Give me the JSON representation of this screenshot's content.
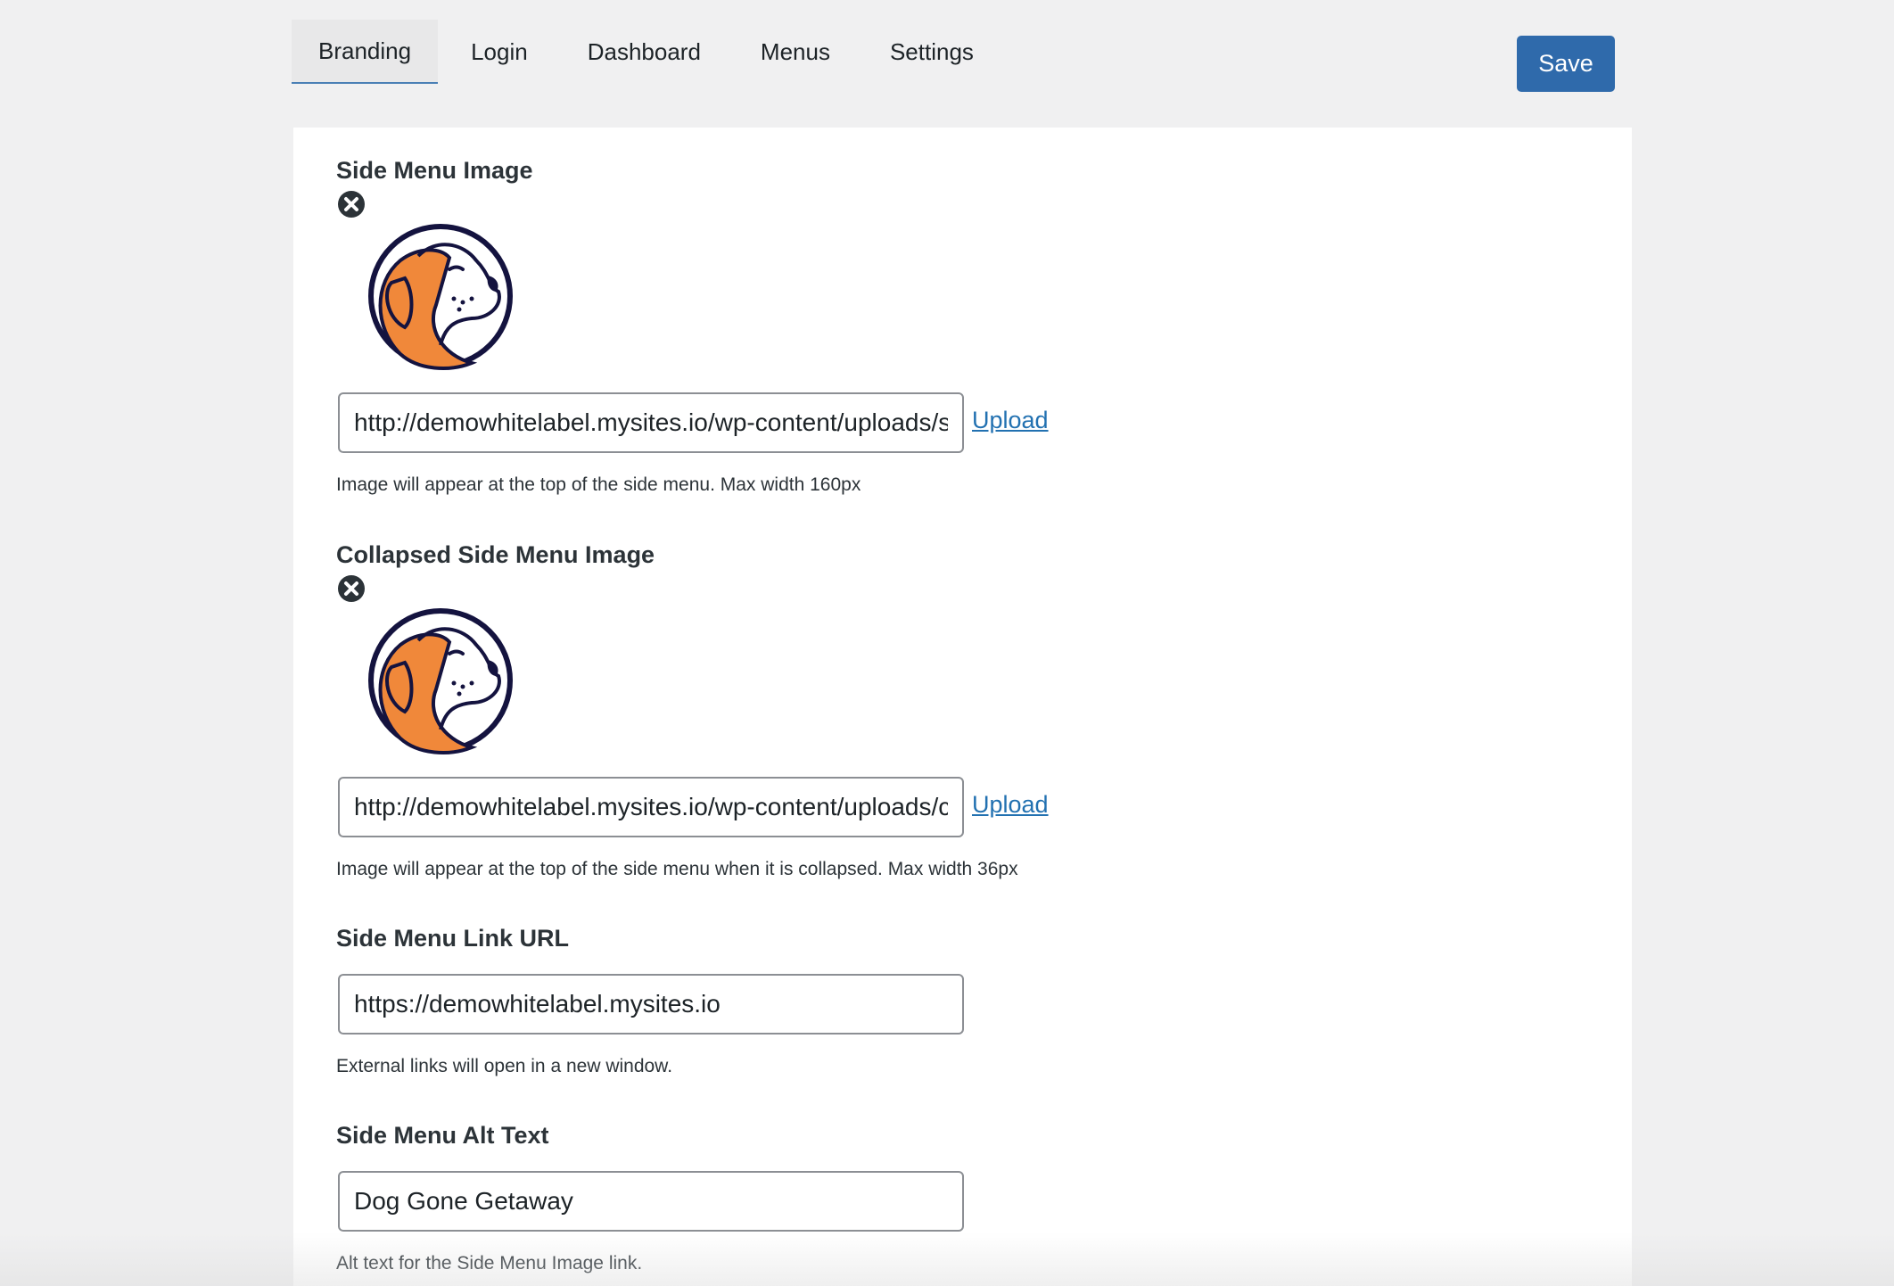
{
  "tabs": [
    {
      "label": "Branding",
      "active": true
    },
    {
      "label": "Login",
      "active": false
    },
    {
      "label": "Dashboard",
      "active": false
    },
    {
      "label": "Menus",
      "active": false
    },
    {
      "label": "Settings",
      "active": false
    }
  ],
  "save_label": "Save",
  "fields": {
    "side_menu_image": {
      "label": "Side Menu Image",
      "value": "http://demowhitelabel.mysites.io/wp-content/uploads/side-menu-logo.png",
      "upload_label": "Upload",
      "help": "Image will appear at the top of the side menu. Max width 160px",
      "remove_icon": "close-circle-icon"
    },
    "collapsed_side_menu_image": {
      "label": "Collapsed Side Menu Image",
      "value": "http://demowhitelabel.mysites.io/wp-content/uploads/collapsed-logo.png",
      "upload_label": "Upload",
      "help": "Image will appear at the top of the side menu when it is collapsed. Max width 36px",
      "remove_icon": "close-circle-icon"
    },
    "side_menu_link_url": {
      "label": "Side Menu Link URL",
      "value": "https://demowhitelabel.mysites.io",
      "help": "External links will open in a new window."
    },
    "side_menu_alt_text": {
      "label": "Side Menu Alt Text",
      "value": "Dog Gone Getaway",
      "help": "Alt text for the Side Menu Image link."
    }
  },
  "colors": {
    "accent": "#2f6aab",
    "link": "#2271b1",
    "logo_orange": "#f0883a",
    "logo_navy": "#14133f"
  }
}
